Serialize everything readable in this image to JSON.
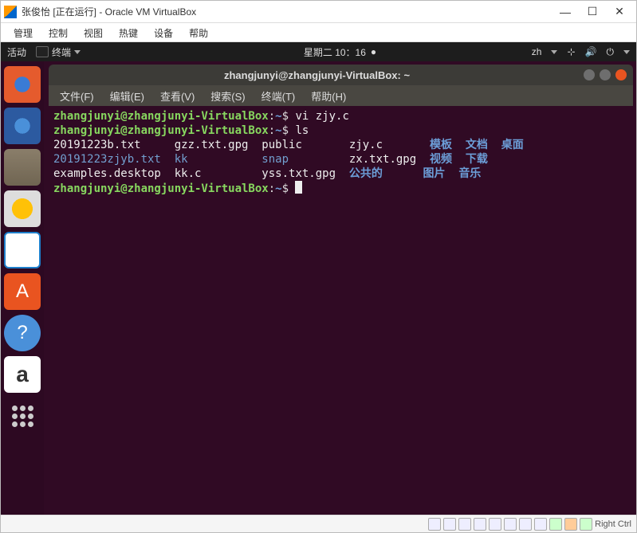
{
  "window": {
    "title": "张俊怡 [正在运行] - Oracle VM VirtualBox",
    "min": "—",
    "max": "☐",
    "close": "✕"
  },
  "vbox_menu": {
    "m1": "管理",
    "m2": "控制",
    "m3": "视图",
    "m4": "热键",
    "m5": "设备",
    "m6": "帮助"
  },
  "gnome": {
    "activities": "活动",
    "app": "终端",
    "clock": "星期二 10：16",
    "lang": "zh"
  },
  "launcher_icons": {
    "software": "A",
    "help": "?",
    "amazon": "a"
  },
  "term": {
    "title": "zhangjunyi@zhangjunyi-VirtualBox: ~",
    "menus": {
      "file": "文件(F)",
      "edit": "编辑(E)",
      "view": "查看(V)",
      "search": "搜索(S)",
      "terminal": "终端(T)",
      "help": "帮助(H)"
    },
    "prompt": {
      "user": "zhangjunyi@zhangjunyi-VirtualBox",
      "path": "~",
      "sep": ":",
      "sym": "$ "
    },
    "cmds": {
      "c1": "vi zjy.c",
      "c2": "ls"
    },
    "ls": {
      "r1": {
        "a": "20191223b.txt     ",
        "b": "gzz.txt.gpg  ",
        "c": "public       ",
        "d": "zjy.c       ",
        "e": "模板  ",
        "f": "文档  ",
        "g": "桌面"
      },
      "r2": {
        "a": "20191223zjyb.txt  ",
        "b": "kk           ",
        "c": "snap         ",
        "d": "zx.txt.gpg  ",
        "e": "视频  ",
        "f": "下载"
      },
      "r3": {
        "a": "examples.desktop  ",
        "b": "kk.c         ",
        "c": "yss.txt.gpg  ",
        "d": "公共的      ",
        "e": "图片  ",
        "f": "音乐"
      }
    }
  },
  "status": {
    "key": "Right Ctrl"
  }
}
